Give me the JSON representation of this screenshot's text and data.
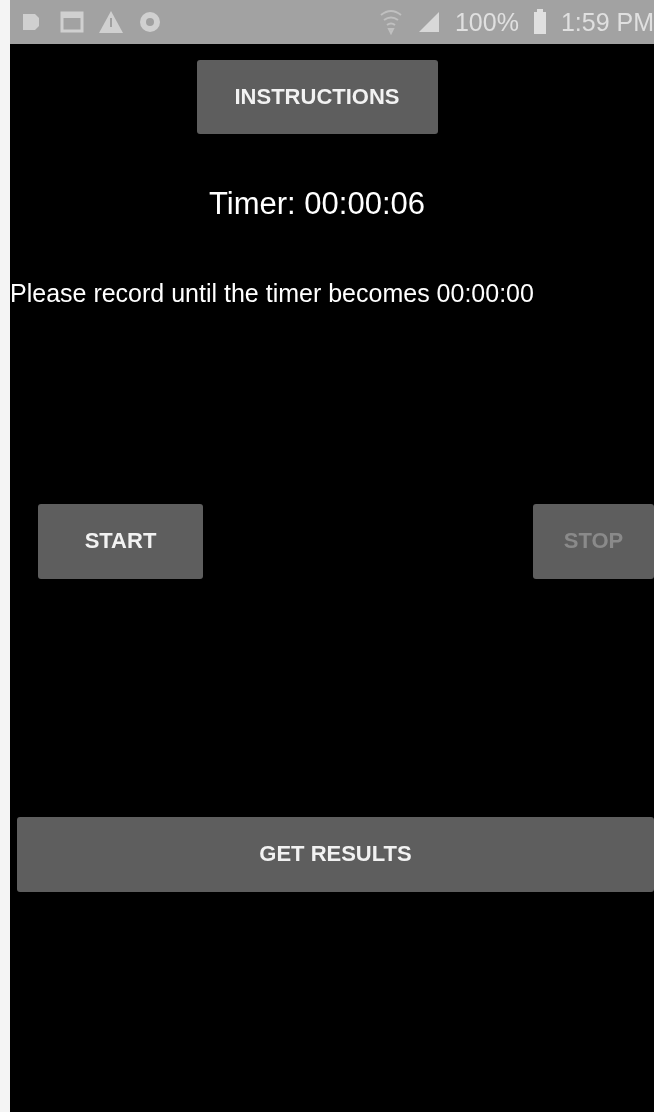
{
  "status_bar": {
    "battery": "100%",
    "time": "1:59 PM"
  },
  "instructions_button": {
    "label": "INSTRUCTIONS",
    "disabled": false
  },
  "timer": "Timer: 00:00:06",
  "message": "Please record until the timer becomes 00:00:00",
  "controls": [
    {
      "label": "START",
      "disabled": false
    },
    {
      "label": "STOP",
      "disabled": true
    }
  ],
  "results_button": {
    "label": "GET RESULTS",
    "disabled": false
  }
}
